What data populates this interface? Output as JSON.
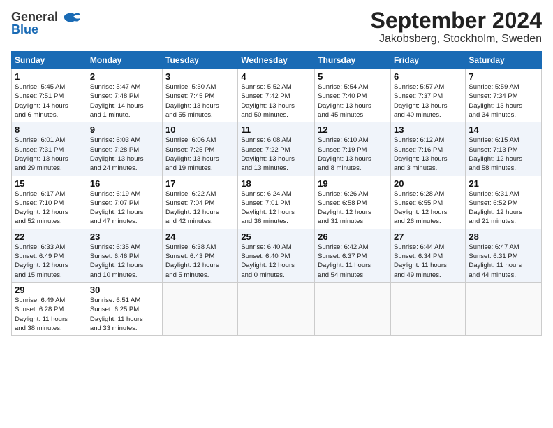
{
  "header": {
    "logo_general": "General",
    "logo_blue": "Blue",
    "title": "September 2024",
    "subtitle": "Jakobsberg, Stockholm, Sweden"
  },
  "days_of_week": [
    "Sunday",
    "Monday",
    "Tuesday",
    "Wednesday",
    "Thursday",
    "Friday",
    "Saturday"
  ],
  "weeks": [
    [
      {
        "day": "1",
        "info": "Sunrise: 5:45 AM\nSunset: 7:51 PM\nDaylight: 14 hours\nand 6 minutes."
      },
      {
        "day": "2",
        "info": "Sunrise: 5:47 AM\nSunset: 7:48 PM\nDaylight: 14 hours\nand 1 minute."
      },
      {
        "day": "3",
        "info": "Sunrise: 5:50 AM\nSunset: 7:45 PM\nDaylight: 13 hours\nand 55 minutes."
      },
      {
        "day": "4",
        "info": "Sunrise: 5:52 AM\nSunset: 7:42 PM\nDaylight: 13 hours\nand 50 minutes."
      },
      {
        "day": "5",
        "info": "Sunrise: 5:54 AM\nSunset: 7:40 PM\nDaylight: 13 hours\nand 45 minutes."
      },
      {
        "day": "6",
        "info": "Sunrise: 5:57 AM\nSunset: 7:37 PM\nDaylight: 13 hours\nand 40 minutes."
      },
      {
        "day": "7",
        "info": "Sunrise: 5:59 AM\nSunset: 7:34 PM\nDaylight: 13 hours\nand 34 minutes."
      }
    ],
    [
      {
        "day": "8",
        "info": "Sunrise: 6:01 AM\nSunset: 7:31 PM\nDaylight: 13 hours\nand 29 minutes."
      },
      {
        "day": "9",
        "info": "Sunrise: 6:03 AM\nSunset: 7:28 PM\nDaylight: 13 hours\nand 24 minutes."
      },
      {
        "day": "10",
        "info": "Sunrise: 6:06 AM\nSunset: 7:25 PM\nDaylight: 13 hours\nand 19 minutes."
      },
      {
        "day": "11",
        "info": "Sunrise: 6:08 AM\nSunset: 7:22 PM\nDaylight: 13 hours\nand 13 minutes."
      },
      {
        "day": "12",
        "info": "Sunrise: 6:10 AM\nSunset: 7:19 PM\nDaylight: 13 hours\nand 8 minutes."
      },
      {
        "day": "13",
        "info": "Sunrise: 6:12 AM\nSunset: 7:16 PM\nDaylight: 13 hours\nand 3 minutes."
      },
      {
        "day": "14",
        "info": "Sunrise: 6:15 AM\nSunset: 7:13 PM\nDaylight: 12 hours\nand 58 minutes."
      }
    ],
    [
      {
        "day": "15",
        "info": "Sunrise: 6:17 AM\nSunset: 7:10 PM\nDaylight: 12 hours\nand 52 minutes."
      },
      {
        "day": "16",
        "info": "Sunrise: 6:19 AM\nSunset: 7:07 PM\nDaylight: 12 hours\nand 47 minutes."
      },
      {
        "day": "17",
        "info": "Sunrise: 6:22 AM\nSunset: 7:04 PM\nDaylight: 12 hours\nand 42 minutes."
      },
      {
        "day": "18",
        "info": "Sunrise: 6:24 AM\nSunset: 7:01 PM\nDaylight: 12 hours\nand 36 minutes."
      },
      {
        "day": "19",
        "info": "Sunrise: 6:26 AM\nSunset: 6:58 PM\nDaylight: 12 hours\nand 31 minutes."
      },
      {
        "day": "20",
        "info": "Sunrise: 6:28 AM\nSunset: 6:55 PM\nDaylight: 12 hours\nand 26 minutes."
      },
      {
        "day": "21",
        "info": "Sunrise: 6:31 AM\nSunset: 6:52 PM\nDaylight: 12 hours\nand 21 minutes."
      }
    ],
    [
      {
        "day": "22",
        "info": "Sunrise: 6:33 AM\nSunset: 6:49 PM\nDaylight: 12 hours\nand 15 minutes."
      },
      {
        "day": "23",
        "info": "Sunrise: 6:35 AM\nSunset: 6:46 PM\nDaylight: 12 hours\nand 10 minutes."
      },
      {
        "day": "24",
        "info": "Sunrise: 6:38 AM\nSunset: 6:43 PM\nDaylight: 12 hours\nand 5 minutes."
      },
      {
        "day": "25",
        "info": "Sunrise: 6:40 AM\nSunset: 6:40 PM\nDaylight: 12 hours\nand 0 minutes."
      },
      {
        "day": "26",
        "info": "Sunrise: 6:42 AM\nSunset: 6:37 PM\nDaylight: 11 hours\nand 54 minutes."
      },
      {
        "day": "27",
        "info": "Sunrise: 6:44 AM\nSunset: 6:34 PM\nDaylight: 11 hours\nand 49 minutes."
      },
      {
        "day": "28",
        "info": "Sunrise: 6:47 AM\nSunset: 6:31 PM\nDaylight: 11 hours\nand 44 minutes."
      }
    ],
    [
      {
        "day": "29",
        "info": "Sunrise: 6:49 AM\nSunset: 6:28 PM\nDaylight: 11 hours\nand 38 minutes."
      },
      {
        "day": "30",
        "info": "Sunrise: 6:51 AM\nSunset: 6:25 PM\nDaylight: 11 hours\nand 33 minutes."
      },
      {
        "day": "",
        "info": ""
      },
      {
        "day": "",
        "info": ""
      },
      {
        "day": "",
        "info": ""
      },
      {
        "day": "",
        "info": ""
      },
      {
        "day": "",
        "info": ""
      }
    ]
  ]
}
